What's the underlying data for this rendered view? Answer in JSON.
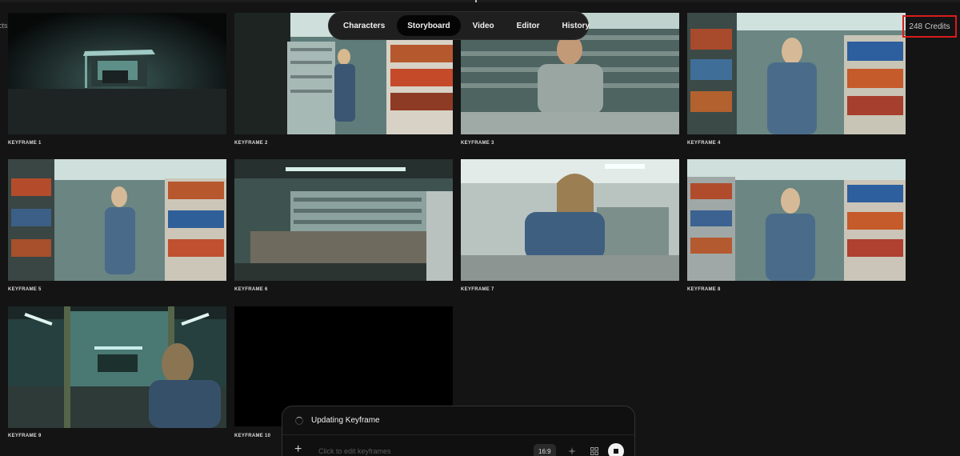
{
  "topbar": {
    "left_text": "cts",
    "mail_icon": "mail-icon",
    "help_icon": "help-circle-icon",
    "credits": "248 Credits"
  },
  "nav": {
    "tabs": [
      {
        "label": "Characters",
        "active": false
      },
      {
        "label": "Storyboard",
        "active": true
      },
      {
        "label": "Video",
        "active": false
      },
      {
        "label": "Editor",
        "active": false
      },
      {
        "label": "History",
        "active": false
      }
    ]
  },
  "keyframes": [
    {
      "label": "KEYFRAME 1"
    },
    {
      "label": "KEYFRAME 2"
    },
    {
      "label": "KEYFRAME 3"
    },
    {
      "label": "KEYFRAME 4"
    },
    {
      "label": "KEYFRAME 5"
    },
    {
      "label": "KEYFRAME 6"
    },
    {
      "label": "KEYFRAME 7"
    },
    {
      "label": "KEYFRAME 8"
    },
    {
      "label": "KEYFRAME 9"
    },
    {
      "label": "KEYFRAME 10"
    }
  ],
  "panel": {
    "status": "Updating Keyframe",
    "prompt_placeholder": "Click to edit keyframes",
    "aspect_ratio": "16:9",
    "icons": [
      "plus-icon",
      "sparkle-icon",
      "grid-icon",
      "stop-icon"
    ]
  },
  "colors": {
    "background": "#141414",
    "credits_highlight": "#d81c1c",
    "active_tab": "#050505"
  }
}
